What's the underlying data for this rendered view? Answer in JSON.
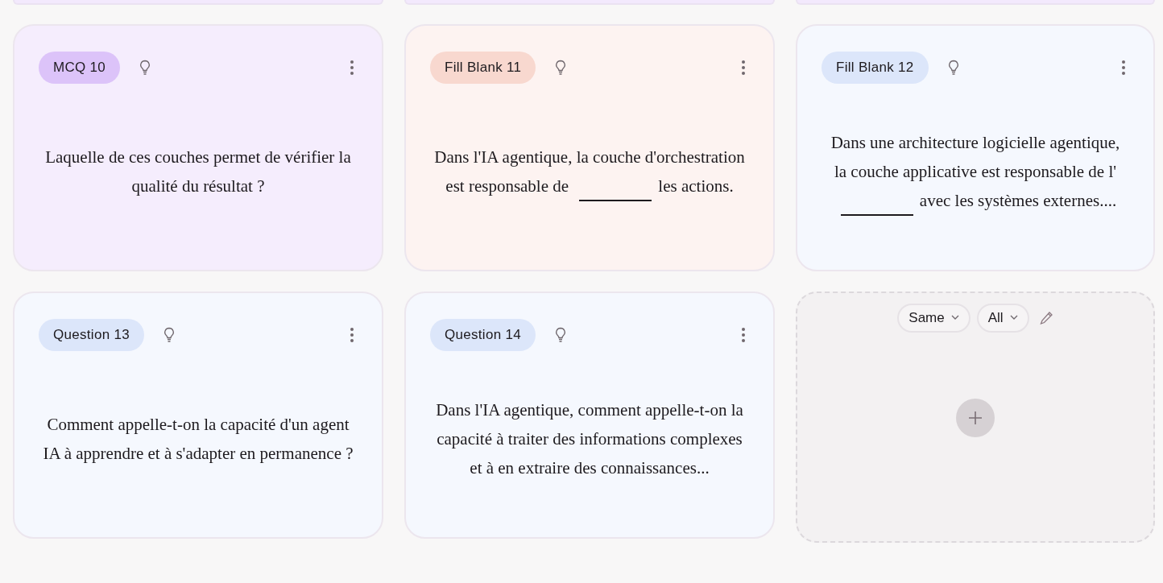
{
  "cut_cards_above": [
    {
      "color": "#f3e9fd"
    },
    {
      "color": "#f3e9fd"
    },
    {
      "color": "#f3e9fd"
    }
  ],
  "cards": [
    {
      "badge": "MCQ 10",
      "color": "#dcc3f9",
      "parts": [
        {
          "kind": "text",
          "text": "Laquelle de ces couches permet de vérifier la qualité du résultat ?"
        }
      ]
    },
    {
      "badge": "Fill Blank 11",
      "color": "#f8d8cf",
      "parts": [
        {
          "kind": "text",
          "text": "Dans l'IA agentique, la couche d'orchestration est responsable de"
        },
        {
          "kind": "blank"
        },
        {
          "kind": "text",
          "text": "les actions."
        }
      ]
    },
    {
      "badge": "Fill Blank 12",
      "color": "#dce6fa",
      "parts": [
        {
          "kind": "text",
          "text": "Dans une architecture logicielle agentique, la couche applicative est responsable de l'"
        },
        {
          "kind": "blank"
        },
        {
          "kind": "text",
          "text": "avec les systèmes externes...."
        }
      ]
    },
    {
      "badge": "Question 13",
      "color": "#dce6fa",
      "parts": [
        {
          "kind": "text",
          "text": "Comment appelle-t-on la capacité d'un agent IA à apprendre et à s'adapter en permanence ?"
        }
      ]
    },
    {
      "badge": "Question 14",
      "color": "#dce6fa",
      "parts": [
        {
          "kind": "text",
          "text": "Dans l'IA agentique, comment appelle-t-on la capacité à traiter des informations complexes et à en extraire des connaissances..."
        }
      ]
    }
  ],
  "new_card": {
    "dropdowns": [
      "Same",
      "All"
    ]
  }
}
